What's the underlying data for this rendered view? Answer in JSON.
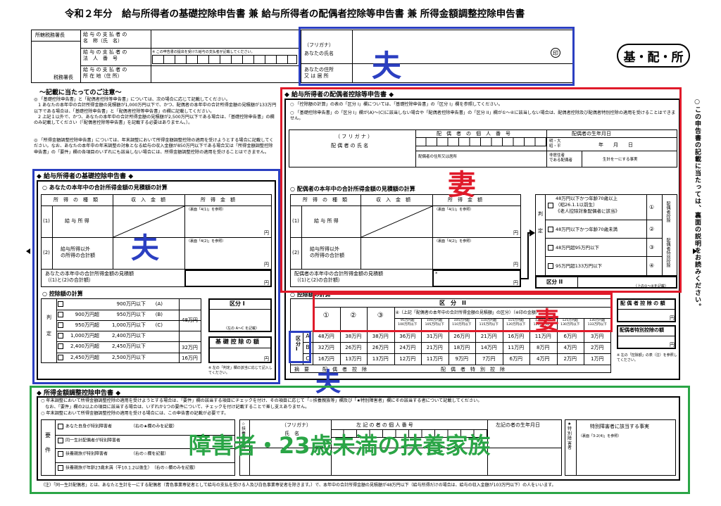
{
  "form": {
    "title": "令和２年分　給与所得者の基礎控除申告書 兼 給与所得者の配偶者控除等申告書 兼 所得金額調整控除申告書",
    "badge": "基・配・所",
    "office_head": "所轄税務署長",
    "tax_office": "税務署長",
    "payer_name": "給 与 の 支 払 者 の\n名　称（氏　名）",
    "payer_number": "給 与 の 支 払 者 の\n法　人　番　号",
    "payer_number_note": "※ この申告書の提出を受けた給与の支払者が記載してください。",
    "payer_address": "給 与 の 支 払 者 の\n所 在 地（住 所）",
    "furigana": "（フリガナ）",
    "your_name": "あなたの氏名",
    "seal": "印",
    "your_address": "あなたの住所\n又 は 居 所"
  },
  "notes": {
    "heading": "～記載に当たってのご注意～",
    "items": [
      "◎ 「基礎控除申告書」と「配偶者控除等申告書」については、次の場合に応じて記載してください。\n　1 あなたの本年中の合計所得金額の見積額が1,000万円以下で、かつ、配偶者の本年中の合計所得金額の見積額が133万円以下である場合は、「基礎控除申告書」と「配偶者控除等申告書」の欄に記載してください。\n　2 上記１以外で、かつ、あなたの本年中の合計所得金額の見積額が2,500万円以下である場合は、「基礎控除申告書」の欄のみ記載してください（「配偶者控除等申告書」を記載する必要はありません。）。",
      "◎ 「所得金額調整控除申告書」については、年末調整において所得金額調整控除の適用を受けようとする場合に記載してください。なお、あなたの本年中の年末調整の対象となる給与の収入金額が850万円以下である場合又は「所得金額調整控除申告書」の「要件」欄の各項目のいずれにも該当しない場合には、所得金額調整控除の適用を受けることはできません。"
    ]
  },
  "basic": {
    "heading": "◆ 給与所得者の基礎控除申告書 ◆",
    "calc_title": "○ あなたの本年中の合計所得金額の見積額の計算",
    "col_type": "所　得　の　種　類",
    "col_income": "収　入　金　額",
    "col_amount": "所　得　金　額",
    "row1_num": "(1)",
    "row1_label": "給 与 所 得",
    "row1_ref": "（裏面「4(1)」を参照）",
    "row2_num": "(2)",
    "row2_label": "給与所得以外\nの所得の合計額",
    "row2_ref": "（裏面「4(2)」を参照）",
    "yen": "円",
    "total_label": "あなたの本年中の合計所得金額の見積額\n（(1)と(2)の合計額）",
    "deduct_title": "○ 控除額の計算",
    "side_left": "判\n\n\n定",
    "ranges": [
      {
        "from": "",
        "to": "900万円以下",
        "code": "(A)"
      },
      {
        "from": "900万円超",
        "to": "950万円以下",
        "code": "(B)"
      },
      {
        "from": "950万円超",
        "to": "1,000万円以下",
        "code": "(C)"
      },
      {
        "from": "1,000万円超",
        "to": "2,400万円以下",
        "code": ""
      },
      {
        "from": "2,400万円超",
        "to": "2,450万円以下",
        "code": ""
      },
      {
        "from": "2,450万円超",
        "to": "2,500万円以下",
        "code": ""
      }
    ],
    "amounts": [
      "48万円",
      "32万円",
      "16万円"
    ],
    "kubun1": "区分 I",
    "kubun1_note": "（左の A～C を記載）",
    "basic_deduction": "基 礎 控 除 の 額",
    "left_note": "※ 左の「判定」欄の該当に応じて記入してください。"
  },
  "spouse": {
    "heading": "◆ 給与所得者の配偶者控除等申告書 ◆",
    "notes": [
      "○ 「控除額の計算」の表の「区分 I」欄については、「基礎控除申告書」の「区分 I」欄を参照してください。",
      "○ 「基礎控除申告書」の「区分 I」欄が(A)～(C)に該当しない場合や「配偶者控除申告書」の「区分 II」欄が①～④に該当しない場合は、配偶者控除及び配偶者特別控除の適用を受けることはできません。"
    ],
    "furigana": "（ フ リ ガ ナ ）",
    "name_label": "配 偶 者 の 氏 名",
    "number_label": "配　偶　者　の　個　人　番　号",
    "birth_label": "配偶者の生年月日",
    "era": "明・大\n昭・平",
    "ymd": "年　　月　　日",
    "address_label": "配偶者の住所又は居所",
    "nonres": "非居住者\nである配偶者",
    "same_living": "生計を一にする事実",
    "calc_title": "○ 配偶者の本年中の合計所得金額の見積額の計算",
    "col_type": "所　得　の　種　類",
    "col_income": "収　入　金　額",
    "col_amount": "所　得　金　額",
    "row1_num": "(1)",
    "row1_label": "給 与 所 得",
    "row1_ref": "（裏面「4(1)」を参照）",
    "row2_num": "(2)",
    "row2_label": "給与所得以外\nの所得の合計額",
    "row2_ref": "（裏面「4(2)」を参照）",
    "yen": "円",
    "total_label": "配偶者の本年中の合計所得金額の見積額\n（(1)と(2)の合計額）",
    "judge_side": "判\n\n\n定",
    "judge_options": [
      {
        "label": "48万円以下かつ年齢70歳以上\n（昭26.1.1以前生）\n《老人控除対象配偶者に該当》",
        "code": "①"
      },
      {
        "label": "48万円以下かつ年齢70歳未満",
        "code": "②"
      },
      {
        "label": "48万円超95万円以下",
        "code": "③"
      },
      {
        "label": "95万円超133万円以下",
        "code": "④"
      }
    ],
    "judge_right": "配偶者控除",
    "judge_right2": "配偶者特別控除",
    "kubun2": "区分 II",
    "kubun2_note": "（上の①～④を記載）",
    "deduct_title": "○ 控除額の計算",
    "kubun2_header": "区　分　II",
    "circled": [
      "①",
      "②",
      "③",
      "④"
    ],
    "col4_header": "④（上記「配偶者の本年中の合計所得金額の見積額」の区分）（※印の金額）",
    "sub_headers": [
      "95万円超\n100万円以下",
      "100万円超\n105万円以下",
      "105万円超\n110万円以下",
      "110万円超\n115万円以下",
      "115万円超\n120万円以下",
      "120万円超\n125万円以下",
      "125万円超\n130万円以下",
      "130万円超\n133万円以下"
    ],
    "kubun1_side": "区\n分\nI",
    "rows": [
      {
        "code": "A",
        "vals": [
          "48万円",
          "38万円",
          "38万円",
          "36万円",
          "31万円",
          "26万円",
          "21万円",
          "16万円",
          "11万円",
          "6万円",
          "3万円"
        ]
      },
      {
        "code": "B",
        "vals": [
          "32万円",
          "26万円",
          "26万円",
          "24万円",
          "21万円",
          "18万円",
          "14万円",
          "11万円",
          "8万円",
          "4万円",
          "2万円"
        ]
      },
      {
        "code": "C",
        "vals": [
          "16万円",
          "13万円",
          "13万円",
          "12万円",
          "11万円",
          "9万円",
          "7万円",
          "6万円",
          "4万円",
          "2万円",
          "1万円"
        ]
      }
    ],
    "summary_left": "摘　要",
    "summary_mid1": "配　偶　者　控　除",
    "summary_mid2": "配　偶　者　特　別　控　除",
    "spouse_ded": "配 偶 者 控 除 の 額",
    "spouse_sp_ded": "配偶者特別控除の額",
    "right_note": "※ 左の「控除額」の表（注）を参照してください。",
    "vertical_note": "○この申告書の記載に当たっては、裏面の説明をお読みください。"
  },
  "adjust": {
    "heading": "◆ 所得金額調整控除申告書 ◆",
    "notes": [
      "○ 年末調整において所得金額調整控除の適用を受けようとする場合は、「要件」欄の該当する項目にチェックを付け、その項目に応じて「☆扶養親族等」欄及び「★特別障害者」欄にその該当する者について記載してください。",
      "　なお、「要件」欄の2以上の項目に該当する場合は、いずれか1つの要件について、チェックを付け記載することで差し支えありません。",
      "○ 年末調整において所得金額調整控除の適用を受ける場合には、この申告書の記載が必要です。"
    ],
    "req_side": "要\n\n件",
    "reqs": [
      "あなた自身が特別障害者　　　　　（右の★欄のみを記載）",
      "同一生計配偶者が特別障害者",
      "扶養親族が特別障害者　　　　　　（右の☆欄を記載）",
      "扶養親族が年齢23歳未満（平10.1.2以後生）　（右の☆欄のみを記載）"
    ],
    "furigana": "（フリガナ）",
    "name_label": "氏　名",
    "number_label": "左 記 の 者 の 個 人 番 号",
    "birth_label": "左記の者の生年月日",
    "special_label": "特別障害者に該当する事実",
    "special_ref": "（裏面「3-2(4)」を参照）",
    "side_star": "★\n特\n別\n障\n害\n者",
    "side_fuyou": "☆\n扶\n養\n親\n族\n等",
    "footnote": "（注）「同一生計配偶者」とは、あなたと生計を一にする配偶者（青色事業専従者として給与の支払を受ける人及び白色事業専従者を除きます。）で、本年中の合計所得金額の見積額が48万円以下（給与所得だけの場合は、給与の収入金額が103万円以下）の人をいいます。"
  },
  "annotations": {
    "husband": "夫",
    "wife": "妻",
    "green_label": "障害者・23歳未満の扶養家族",
    "colors": {
      "blue": "#2b3fc1",
      "red": "#e01a2a",
      "green": "#2aa546"
    }
  }
}
